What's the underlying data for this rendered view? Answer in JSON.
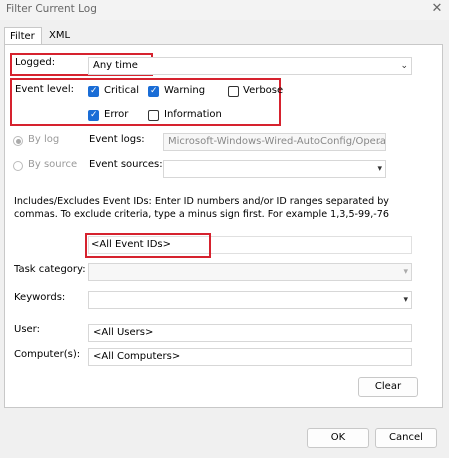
{
  "window": {
    "title": "Filter Current Log",
    "close_glyph": "✕"
  },
  "tabs": [
    {
      "label": "Filter"
    },
    {
      "label": "XML"
    }
  ],
  "logged": {
    "label": "Logged:",
    "value": "Any time"
  },
  "event_level": {
    "label": "Event level:",
    "items": [
      {
        "label": "Critical",
        "checked": true
      },
      {
        "label": "Warning",
        "checked": true
      },
      {
        "label": "Verbose",
        "checked": false
      },
      {
        "label": "Error",
        "checked": true
      },
      {
        "label": "Information",
        "checked": false
      }
    ]
  },
  "source": {
    "by_log_label": "By log",
    "by_source_label": "By source",
    "event_logs_label": "Event logs:",
    "event_logs_value": "Microsoft-Windows-Wired-AutoConfig/Operat",
    "event_sources_label": "Event sources:",
    "event_sources_value": ""
  },
  "help_text": "Includes/Excludes Event IDs: Enter ID numbers and/or ID ranges separated by commas. To exclude criteria, type a minus sign first. For example 1,3,5-99,-76",
  "event_ids": {
    "value": "<All Event IDs>"
  },
  "task_category": {
    "label": "Task category:",
    "value": ""
  },
  "keywords": {
    "label": "Keywords:",
    "value": ""
  },
  "user": {
    "label": "User:",
    "value": "<All Users>"
  },
  "computer": {
    "label": "Computer(s):",
    "value": "<All Computers>"
  },
  "buttons": {
    "clear": "Clear",
    "ok": "OK",
    "cancel": "Cancel"
  },
  "icons": {
    "dropdown": "chevron-down-icon",
    "close": "close-icon"
  },
  "colors": {
    "highlight": "#d6222e",
    "checkbox_checked": "#1a6dd6"
  }
}
